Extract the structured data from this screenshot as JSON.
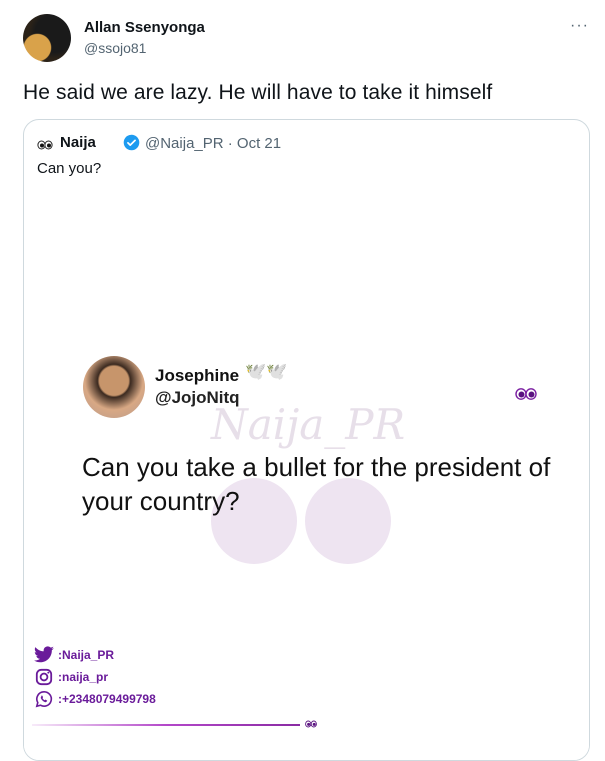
{
  "tweet": {
    "author_name": "Allan Ssenyonga",
    "author_handle": "@ssojo81",
    "more": "···",
    "text": "He said we are lazy. He will have to take it himself"
  },
  "quoted": {
    "name": "Naija",
    "handle_date": "@Naija_PR · Oct 21",
    "text": "Can you?",
    "media": {
      "watermark": "Naija_PR",
      "inner_name": "Josephine",
      "inner_emoji": "🕊️🕊️",
      "inner_handle": "@JojoNitq",
      "question": "Can you take a bullet for the president of your country?",
      "twitter_label": ":Naija_PR",
      "instagram_label": ":naija_pr",
      "whatsapp_label": ":+2348079499798"
    }
  },
  "colors": {
    "verified": "#1d9bf0",
    "brand_purple": "#6a1b9a"
  }
}
